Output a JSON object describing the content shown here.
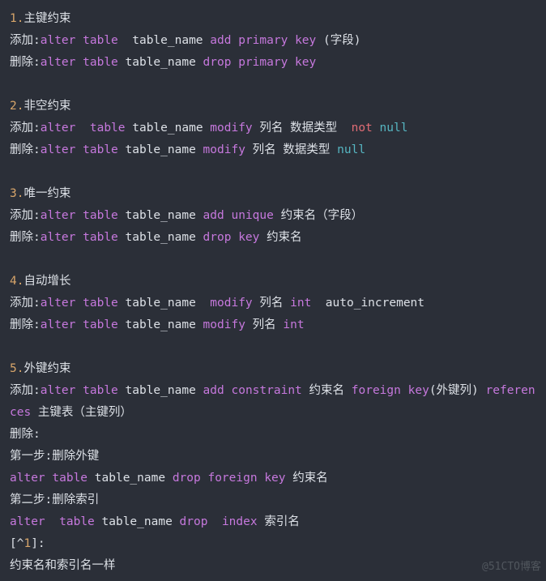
{
  "lines": [
    [
      {
        "c": "num",
        "t": "1."
      },
      {
        "c": "plain",
        "t": "主键约束"
      }
    ],
    [
      {
        "c": "plain",
        "t": "添加:"
      },
      {
        "c": "kw",
        "t": "alter"
      },
      {
        "c": "plain",
        "t": " "
      },
      {
        "c": "kw",
        "t": "table"
      },
      {
        "c": "plain",
        "t": "  table_name "
      },
      {
        "c": "kw",
        "t": "add"
      },
      {
        "c": "plain",
        "t": " "
      },
      {
        "c": "kw",
        "t": "primary"
      },
      {
        "c": "plain",
        "t": " "
      },
      {
        "c": "kw",
        "t": "key"
      },
      {
        "c": "plain",
        "t": " (字段)"
      }
    ],
    [
      {
        "c": "plain",
        "t": "删除:"
      },
      {
        "c": "kw",
        "t": "alter"
      },
      {
        "c": "plain",
        "t": " "
      },
      {
        "c": "kw",
        "t": "table"
      },
      {
        "c": "plain",
        "t": " table_name "
      },
      {
        "c": "kw",
        "t": "drop"
      },
      {
        "c": "plain",
        "t": " "
      },
      {
        "c": "kw",
        "t": "primary"
      },
      {
        "c": "plain",
        "t": " "
      },
      {
        "c": "kw",
        "t": "key"
      }
    ],
    [],
    [
      {
        "c": "num",
        "t": "2."
      },
      {
        "c": "plain",
        "t": "非空约束"
      }
    ],
    [
      {
        "c": "plain",
        "t": "添加:"
      },
      {
        "c": "kw",
        "t": "alter"
      },
      {
        "c": "plain",
        "t": "  "
      },
      {
        "c": "kw",
        "t": "table"
      },
      {
        "c": "plain",
        "t": " table_name "
      },
      {
        "c": "kw",
        "t": "modify"
      },
      {
        "c": "plain",
        "t": " 列名 数据类型  "
      },
      {
        "c": "red",
        "t": "not"
      },
      {
        "c": "plain",
        "t": " "
      },
      {
        "c": "teal",
        "t": "null"
      }
    ],
    [
      {
        "c": "plain",
        "t": "删除:"
      },
      {
        "c": "kw",
        "t": "alter"
      },
      {
        "c": "plain",
        "t": " "
      },
      {
        "c": "kw",
        "t": "table"
      },
      {
        "c": "plain",
        "t": " table_name "
      },
      {
        "c": "kw",
        "t": "modify"
      },
      {
        "c": "plain",
        "t": " 列名 数据类型 "
      },
      {
        "c": "teal",
        "t": "null"
      }
    ],
    [],
    [
      {
        "c": "num",
        "t": "3."
      },
      {
        "c": "plain",
        "t": "唯一约束"
      }
    ],
    [
      {
        "c": "plain",
        "t": "添加:"
      },
      {
        "c": "kw",
        "t": "alter"
      },
      {
        "c": "plain",
        "t": " "
      },
      {
        "c": "kw",
        "t": "table"
      },
      {
        "c": "plain",
        "t": " table_name "
      },
      {
        "c": "kw",
        "t": "add"
      },
      {
        "c": "plain",
        "t": " "
      },
      {
        "c": "kw",
        "t": "unique"
      },
      {
        "c": "plain",
        "t": " 约束名（字段）"
      }
    ],
    [
      {
        "c": "plain",
        "t": "删除:"
      },
      {
        "c": "kw",
        "t": "alter"
      },
      {
        "c": "plain",
        "t": " "
      },
      {
        "c": "kw",
        "t": "table"
      },
      {
        "c": "plain",
        "t": " table_name "
      },
      {
        "c": "kw",
        "t": "drop"
      },
      {
        "c": "plain",
        "t": " "
      },
      {
        "c": "kw",
        "t": "key"
      },
      {
        "c": "plain",
        "t": " 约束名"
      }
    ],
    [],
    [
      {
        "c": "num",
        "t": "4."
      },
      {
        "c": "plain",
        "t": "自动增长"
      }
    ],
    [
      {
        "c": "plain",
        "t": "添加:"
      },
      {
        "c": "kw",
        "t": "alter"
      },
      {
        "c": "plain",
        "t": " "
      },
      {
        "c": "kw",
        "t": "table"
      },
      {
        "c": "plain",
        "t": " table_name  "
      },
      {
        "c": "kw",
        "t": "modify"
      },
      {
        "c": "plain",
        "t": " 列名 "
      },
      {
        "c": "kw",
        "t": "int"
      },
      {
        "c": "plain",
        "t": "  auto_increment"
      }
    ],
    [
      {
        "c": "plain",
        "t": "删除:"
      },
      {
        "c": "kw",
        "t": "alter"
      },
      {
        "c": "plain",
        "t": " "
      },
      {
        "c": "kw",
        "t": "table"
      },
      {
        "c": "plain",
        "t": " table_name "
      },
      {
        "c": "kw",
        "t": "modify"
      },
      {
        "c": "plain",
        "t": " 列名 "
      },
      {
        "c": "kw",
        "t": "int"
      }
    ],
    [],
    [
      {
        "c": "num",
        "t": "5."
      },
      {
        "c": "plain",
        "t": "外键约束"
      }
    ],
    [
      {
        "c": "plain",
        "t": "添加:"
      },
      {
        "c": "kw",
        "t": "alter"
      },
      {
        "c": "plain",
        "t": " "
      },
      {
        "c": "kw",
        "t": "table"
      },
      {
        "c": "plain",
        "t": " table_name "
      },
      {
        "c": "kw",
        "t": "add"
      },
      {
        "c": "plain",
        "t": " "
      },
      {
        "c": "kw",
        "t": "constraint"
      },
      {
        "c": "plain",
        "t": " 约束名 "
      },
      {
        "c": "kw",
        "t": "foreign"
      },
      {
        "c": "plain",
        "t": " "
      },
      {
        "c": "kw",
        "t": "key"
      },
      {
        "c": "plain",
        "t": "(外键列) "
      },
      {
        "c": "kw",
        "t": "references"
      },
      {
        "c": "plain",
        "t": " 主键表（主键列）"
      }
    ],
    [
      {
        "c": "plain",
        "t": "删除:"
      }
    ],
    [
      {
        "c": "plain",
        "t": "第一步:删除外键"
      }
    ],
    [
      {
        "c": "kw",
        "t": "alter"
      },
      {
        "c": "plain",
        "t": " "
      },
      {
        "c": "kw",
        "t": "table"
      },
      {
        "c": "plain",
        "t": " table_name "
      },
      {
        "c": "kw",
        "t": "drop"
      },
      {
        "c": "plain",
        "t": " "
      },
      {
        "c": "kw",
        "t": "foreign"
      },
      {
        "c": "plain",
        "t": " "
      },
      {
        "c": "kw",
        "t": "key"
      },
      {
        "c": "plain",
        "t": " 约束名"
      }
    ],
    [
      {
        "c": "plain",
        "t": "第二步:删除索引"
      }
    ],
    [
      {
        "c": "kw",
        "t": "alter"
      },
      {
        "c": "plain",
        "t": "  "
      },
      {
        "c": "kw",
        "t": "table"
      },
      {
        "c": "plain",
        "t": " table_name "
      },
      {
        "c": "kw",
        "t": "drop"
      },
      {
        "c": "plain",
        "t": "  "
      },
      {
        "c": "kw",
        "t": "index"
      },
      {
        "c": "plain",
        "t": " 索引名"
      }
    ],
    [
      {
        "c": "plain",
        "t": "[^"
      },
      {
        "c": "num",
        "t": "1"
      },
      {
        "c": "plain",
        "t": "]:"
      }
    ],
    [
      {
        "c": "plain",
        "t": "约束名和索引名一样"
      }
    ]
  ],
  "watermark": "@51CTO博客"
}
